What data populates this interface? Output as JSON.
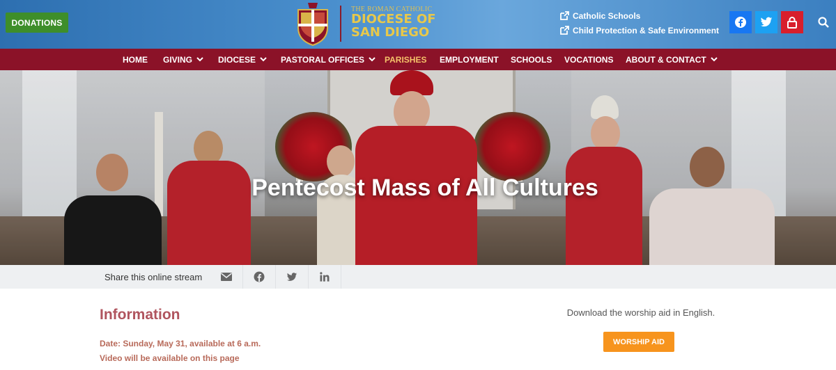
{
  "header": {
    "donations_label": "DONATIONS",
    "logo_small": "THE ROMAN CATHOLIC",
    "logo_line1": "DIOCESE OF",
    "logo_line2": "SAN DIEGO",
    "quick_links": [
      "Catholic Schools",
      "Child Protection & Safe Environment"
    ],
    "social_icons": [
      "facebook-icon",
      "twitter-icon",
      "lock-icon",
      "search-icon"
    ],
    "colors": {
      "facebook": "#1877f2",
      "twitter": "#1da1f2",
      "lock": "#d81f2c",
      "donations": "#3e8e2a"
    }
  },
  "nav": {
    "items": [
      {
        "label": "HOME",
        "dropdown": false
      },
      {
        "label": "GIVING",
        "dropdown": true
      },
      {
        "label": "DIOCESE",
        "dropdown": true
      },
      {
        "label": "PASTORAL OFFICES",
        "dropdown": true
      },
      {
        "label": "PARISHES",
        "dropdown": false,
        "active": true
      },
      {
        "label": "EMPLOYMENT",
        "dropdown": false
      },
      {
        "label": "SCHOOLS",
        "dropdown": false
      },
      {
        "label": "VOCATIONS",
        "dropdown": false
      },
      {
        "label": "ABOUT & CONTACT",
        "dropdown": true
      }
    ],
    "background": "#8b1228",
    "active_color": "#f5c36a"
  },
  "hero": {
    "title": "Pentecost Mass of All Cultures"
  },
  "share": {
    "label": "Share this online stream",
    "icons": [
      "email-icon",
      "facebook-icon",
      "twitter-icon",
      "linkedin-icon"
    ]
  },
  "info": {
    "heading": "Information",
    "date_line": "Date: Sunday, May 31, available at 6 a.m.",
    "video_line": "Video will be available on this page"
  },
  "worship_aid": {
    "text": "Download the worship aid in English.",
    "button_label": "WORSHIP AID",
    "button_color": "#f7941d"
  }
}
